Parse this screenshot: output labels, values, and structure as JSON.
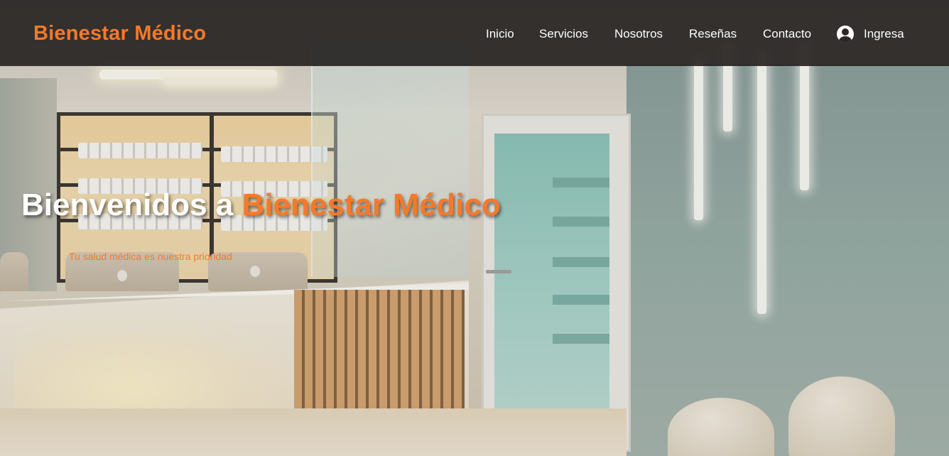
{
  "nav": {
    "brand": "Bienestar Médico",
    "links": [
      {
        "label": "Inicio"
      },
      {
        "label": "Servicios"
      },
      {
        "label": "Nosotros"
      },
      {
        "label": "Reseñas"
      },
      {
        "label": "Contacto"
      }
    ],
    "login": {
      "label": "Ingresa",
      "icon": "user-circle-icon"
    }
  },
  "hero": {
    "title_prefix": "Bienvenidos a ",
    "title_accent": "Bienestar Médico",
    "subtitle": "Tu salud médica es nuestra prioridad"
  },
  "colors": {
    "accent": "#f5792a",
    "navbar_bg": "#282523",
    "text_light": "#ffffff"
  }
}
